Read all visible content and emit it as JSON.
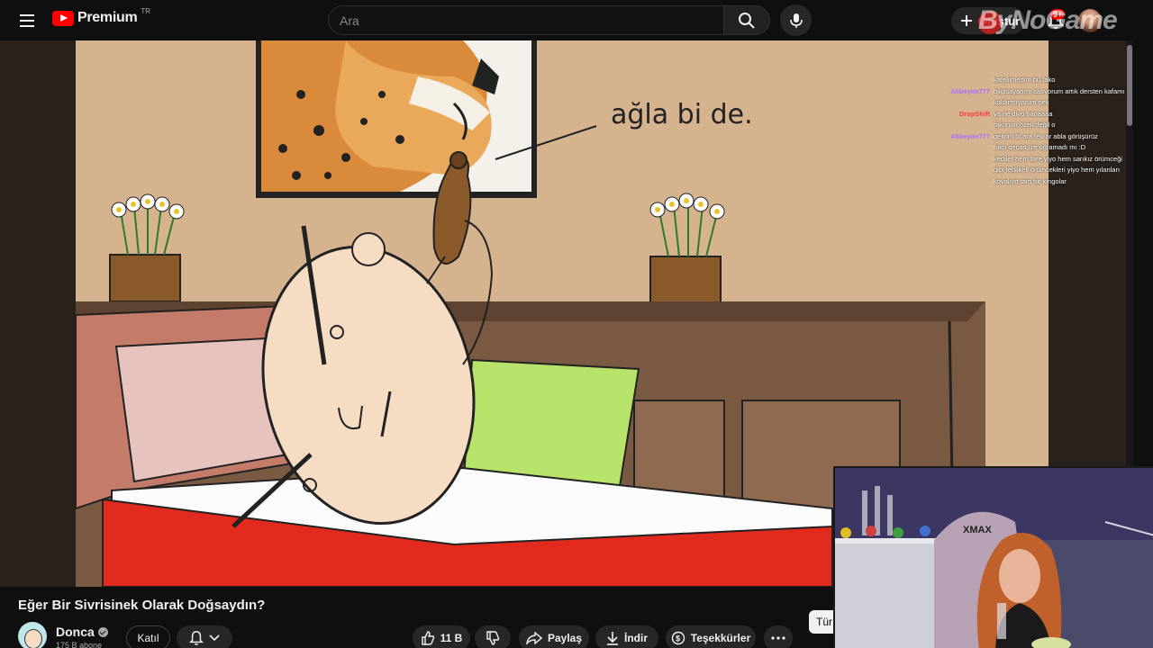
{
  "header": {
    "logo_text": "Premium",
    "logo_region": "TR",
    "search_placeholder": "Ara",
    "create_label": "Oluştur",
    "notification_count": "9+",
    "watermark": "ByNoGame"
  },
  "video": {
    "drawn_text": "ağla bi de."
  },
  "chat": [
    {
      "user": "",
      "color": "#ffffff",
      "msg": "kafeliimedim bu fako"
    },
    {
      "user": "Alibeyim777",
      "color": "#b06cff",
      "msg": "bilgisayarımı satıyorum artık dersten kafamı"
    },
    {
      "user": "",
      "color": "#ffffff",
      "msg": "kaldırmıyorum pek"
    },
    {
      "user": "DropShift",
      "color": "#ff3b3b",
      "msg": "ya ne diyo banaaaa"
    },
    {
      "user": "",
      "color": "#ffffff",
      "msg": "fakonun özeli değil o"
    },
    {
      "user": "Alibeyim777",
      "color": "#b06cff",
      "msg": "gelirim bi ara tekrar abla görüşürüz"
    },
    {
      "user": "",
      "color": "#7cff7c",
      "msg": "fako decasuze uğramadı mı :D"
    },
    {
      "user": "",
      "color": "#4ad0a0",
      "msg": "kediler hem fare yiyo hem sarıkız örümceği"
    },
    {
      "user": "",
      "color": "#ffffff",
      "msg": "gibi tehlikeli örümcekleri yiyo hem yılanları"
    },
    {
      "user": "",
      "color": "#ffffff",
      "msg": "kovalıyo tam bir kingolar"
    }
  ],
  "meta": {
    "title": "Eğer Bir Sivrisinek Olarak Doğsaydın?",
    "channel": "Donca",
    "subscribers": "175 B abone",
    "join_label": "Katıl",
    "like_count": "11 B",
    "share_label": "Paylaş",
    "download_label": "İndir",
    "thanks_label": "Teşekkürler",
    "tur_label": "Tür",
    "webcam_chair_text": "XMAX"
  }
}
